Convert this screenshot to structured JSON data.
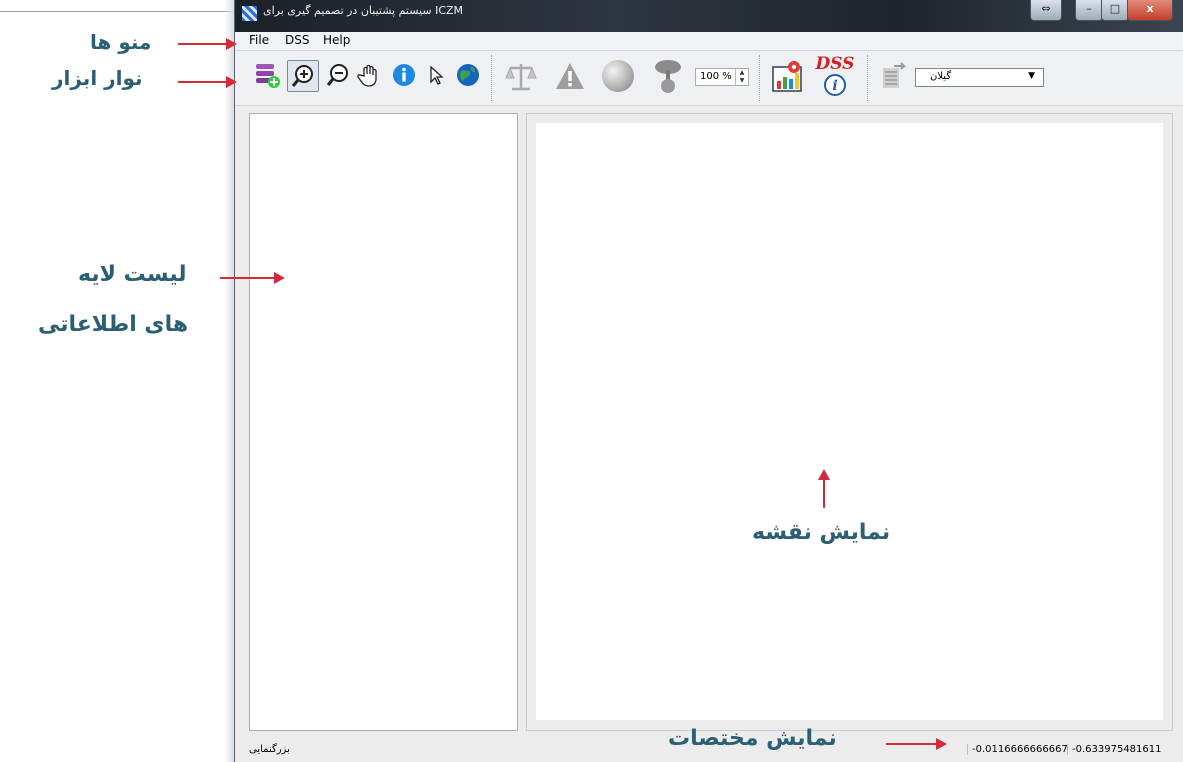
{
  "window": {
    "title": "سیستم پشتیبان در تصمیم گیری برای ICZM",
    "controls": {
      "restore_left": "⇔",
      "minimize": "–",
      "maximize": "□",
      "close": "x"
    }
  },
  "menu": {
    "items": [
      {
        "label": "File"
      },
      {
        "label": "DSS"
      },
      {
        "label": "Help"
      }
    ]
  },
  "toolbar": {
    "tools": [
      {
        "name": "add-layer-icon"
      },
      {
        "name": "zoom-in-icon"
      },
      {
        "name": "zoom-out-icon"
      },
      {
        "name": "pan-hand-icon"
      },
      {
        "name": "info-icon"
      },
      {
        "name": "select-arrow-icon"
      },
      {
        "name": "globe-icon"
      },
      {
        "name": "balance-scale-icon"
      },
      {
        "name": "warning-icon"
      },
      {
        "name": "sphere-icon"
      },
      {
        "name": "tree-icon"
      }
    ],
    "zoom_value": "100 %",
    "dss_tools": [
      {
        "name": "map-chart-icon"
      },
      {
        "name": "dss-info-icon",
        "text": "DSS"
      }
    ],
    "export_icon": "export-icon",
    "province_selected": "گیلان"
  },
  "status": {
    "left_label": "بزرگنمایی",
    "coord_x": "-0.0116666666667",
    "coord_y": "-0.633975481611"
  },
  "annotations": {
    "menus": "منو ها",
    "toolbar": "نوار ابزار",
    "layers_line1": "لیست لایه",
    "layers_line2": "های اطلاعاتی",
    "map": "نمایش نقشه",
    "coordinates": "نمایش مختصات"
  },
  "colors": {
    "annotation_text": "#2b5f73",
    "annotation_arrow": "#d42a3a"
  }
}
